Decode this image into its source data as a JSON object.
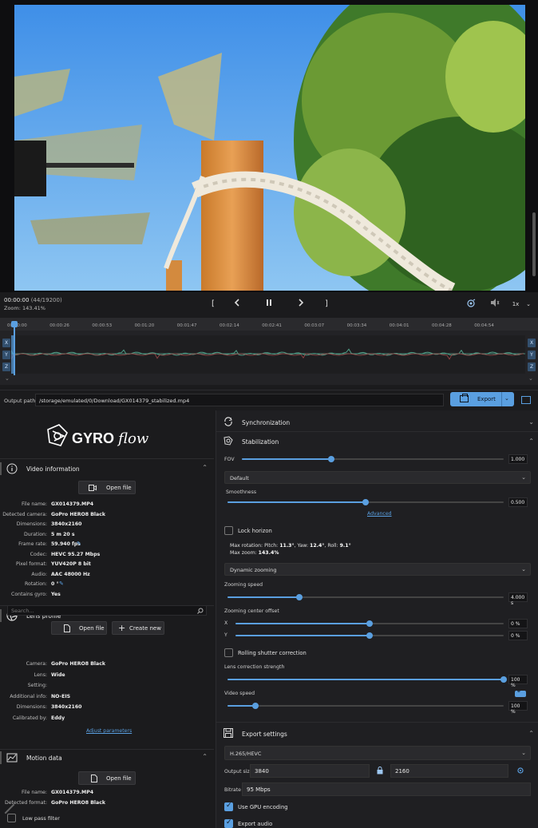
{
  "playback": {
    "timecode": "00:00:00",
    "frame_info": "(44/19200)",
    "zoom": "Zoom: 143.41%",
    "speed": "1x"
  },
  "timeline": {
    "ticks": [
      "00:00:00",
      "00:00:26",
      "00:00:53",
      "00:01:20",
      "00:01:47",
      "00:02:14",
      "00:02:41",
      "00:03:07",
      "00:03:34",
      "00:04:01",
      "00:04:28",
      "00:04:54"
    ],
    "axes": [
      "X",
      "Y",
      "Z"
    ]
  },
  "output": {
    "label": "Output path:",
    "path": "/storage/emulated/0/Download/GX014379_stabilized.mp4",
    "export_label": "Export"
  },
  "video_info": {
    "title": "Video information",
    "open_file": "Open file",
    "rows": [
      {
        "k": "File name:",
        "v": "GX014379.MP4"
      },
      {
        "k": "Detected camera:",
        "v": "GoPro HERO8 Black"
      },
      {
        "k": "Dimensions:",
        "v": "3840x2160"
      },
      {
        "k": "Duration:",
        "v": "5 m 20 s"
      },
      {
        "k": "Frame rate:",
        "v": "59.940 fps"
      },
      {
        "k": "Codec:",
        "v": "HEVC 95.27 Mbps"
      },
      {
        "k": "Pixel format:",
        "v": "YUV420P 8 bit"
      },
      {
        "k": "Audio:",
        "v": "AAC 48000 Hz"
      },
      {
        "k": "Rotation:",
        "v": "0 °"
      },
      {
        "k": "Contains gyro:",
        "v": "Yes"
      }
    ]
  },
  "lens_profile": {
    "title": "Lens profile",
    "search_placeholder": "Search...",
    "open_file": "Open file",
    "create_new": "Create new",
    "rows": [
      {
        "k": "Camera:",
        "v": "GoPro HERO8 Black"
      },
      {
        "k": "Lens:",
        "v": "Wide"
      },
      {
        "k": "Setting:",
        "v": ""
      },
      {
        "k": "Additional info:",
        "v": "NO-EIS"
      },
      {
        "k": "Dimensions:",
        "v": "3840x2160"
      },
      {
        "k": "Calibrated by:",
        "v": "Eddy"
      }
    ],
    "adjust_link": "Adjust parameters"
  },
  "motion_data": {
    "title": "Motion data",
    "open_file": "Open file",
    "rows": [
      {
        "k": "File name:",
        "v": "GX014379.MP4"
      },
      {
        "k": "Detected format:",
        "v": "GoPro HERO8 Black"
      }
    ],
    "low_pass": "Low pass filter"
  },
  "sync": {
    "title": "Synchronization"
  },
  "stabilization": {
    "title": "Stabilization",
    "fov_label": "FOV",
    "fov_value": "1.000",
    "fov_fraction": 0.34,
    "method": "Default",
    "smoothness_label": "Smoothness",
    "smoothness_value": "0.500",
    "smoothness_fraction": 0.5,
    "advanced": "Advanced",
    "lock_horizon": "Lock horizon",
    "max_rotation_prefix": "Max rotation: Pitch: ",
    "pitch": "11.3°",
    "yaw_prefix": ", Yaw: ",
    "yaw": "12.4°",
    "roll_prefix": ", Roll: ",
    "roll": "9.1°",
    "max_zoom_prefix": "Max zoom: ",
    "max_zoom": "143.4%",
    "dynamic_zooming": "Dynamic zooming",
    "zooming_speed_label": "Zooming speed",
    "zooming_speed_value": "4.000 s",
    "zooming_speed_fraction": 0.26,
    "zoom_center_label": "Zooming center offset",
    "x_label": "X",
    "x_value": "0 %",
    "y_label": "Y",
    "y_value": "0 %",
    "offset_fraction": 0.5,
    "rolling_shutter": "Rolling shutter correction",
    "lens_strength_label": "Lens correction strength",
    "lens_strength_value": "100 %",
    "lens_strength_fraction": 1.0,
    "video_speed_label": "Video speed",
    "video_speed_value": "100 %",
    "video_speed_fraction": 0.1
  },
  "export_settings": {
    "title": "Export settings",
    "codec": "H.265/HEVC",
    "output_size_label": "Output size",
    "width": "3840",
    "height": "2160",
    "bitrate_label": "Bitrate",
    "bitrate": "95 Mbps",
    "use_gpu": "Use GPU encoding",
    "export_audio": "Export audio"
  },
  "colors": {
    "accent": "#5a9fe0",
    "background": "#1b1b1d",
    "panel": "#1f1f22"
  }
}
